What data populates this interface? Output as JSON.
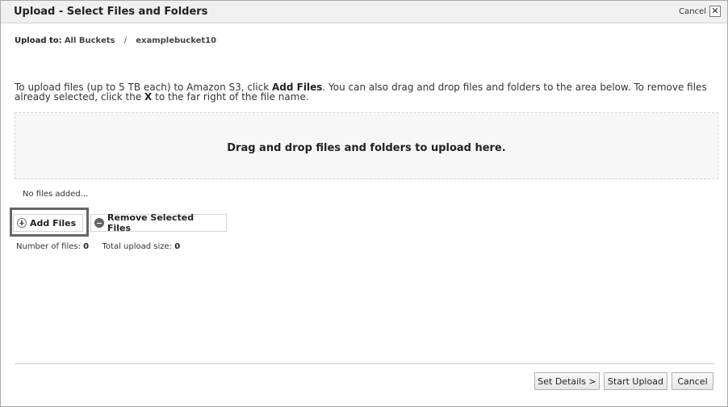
{
  "dialog": {
    "title": "Upload - Select Files and Folders",
    "cancel_label": "Cancel",
    "close_glyph": "✕"
  },
  "breadcrumb": {
    "label": "Upload to:",
    "root": "All Buckets",
    "separator": "/",
    "bucket": "examplebucket10"
  },
  "instructions": {
    "part1": "To upload files (up to 5 TB each) to Amazon S3, click ",
    "add_files_bold": "Add Files",
    "part2": ". You can also drag and drop files and folders to the area below. To remove files already selected, click the ",
    "x_bold": "X",
    "part3": " to the far right of the file name."
  },
  "dropzone": {
    "text": "Drag and drop files and folders to upload here."
  },
  "file_list": {
    "empty_text": "No files added..."
  },
  "buttons": {
    "add_files": "Add Files",
    "remove_selected": "Remove Selected Files"
  },
  "stats": {
    "files_label": "Number of files:",
    "files_value": "0",
    "size_label": "Total upload size:",
    "size_value": "0"
  },
  "footer": {
    "set_details": "Set Details >",
    "start_upload": "Start Upload",
    "cancel": "Cancel"
  },
  "icons": {
    "add": "plus-circle-icon",
    "remove": "minus-circle-icon",
    "close": "close-icon"
  }
}
